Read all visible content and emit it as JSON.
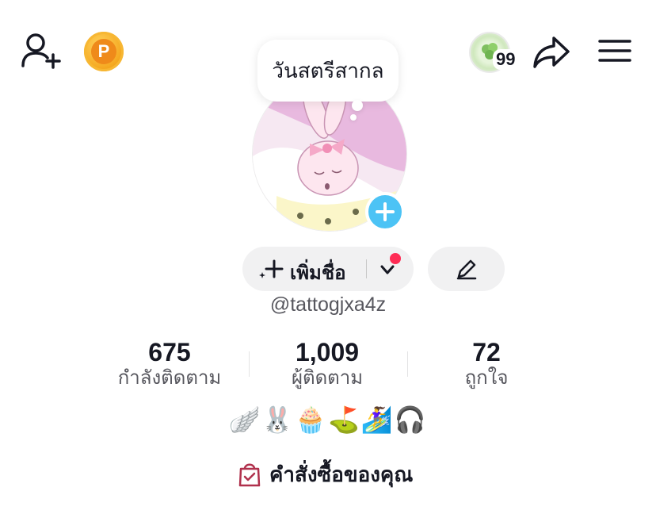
{
  "header": {
    "story_count": "99",
    "coin_letter": "P"
  },
  "tooltip": {
    "text": "วันสตรีสากล"
  },
  "profile": {
    "add_name_label": "เพิ่มชื่อ",
    "username": "@tattogjxa4z"
  },
  "stats": [
    {
      "value": "675",
      "label": "กำลังติดตาม"
    },
    {
      "value": "1,009",
      "label": "ผู้ติดตาม"
    },
    {
      "value": "72",
      "label": "ถูกใจ"
    }
  ],
  "bio": {
    "emojis": "🪽🐰🧁⛳🏄‍♀️🎧"
  },
  "orders": {
    "label": "คำสั่งซื้อของคุณ"
  },
  "colors": {
    "accent_blue": "#4cc3f5",
    "notification_red": "#fe2c55",
    "coin_orange": "#f4a51c",
    "orders_icon": "#b0304c"
  },
  "icons": [
    "add-friend-icon",
    "coin-icon",
    "share-icon",
    "menu-icon",
    "plus-icon",
    "sparkle-icon",
    "chevron-down-icon",
    "pencil-icon",
    "shopping-bag-icon"
  ]
}
